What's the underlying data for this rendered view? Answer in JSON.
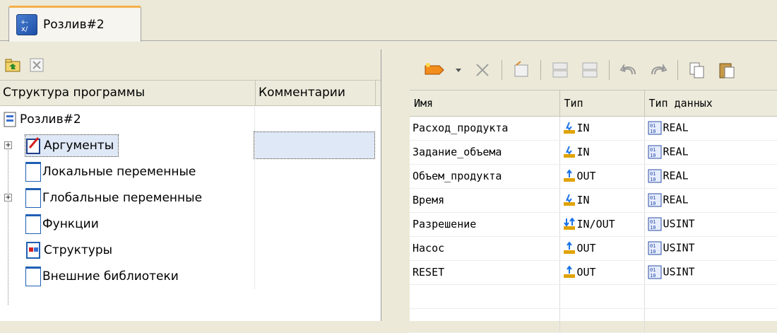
{
  "tab": {
    "label": "Розлив#2"
  },
  "left_pane": {
    "columns": [
      "Структура программы",
      "Комментарии"
    ],
    "tree": [
      {
        "label": "Розлив#2",
        "icon": "program-icon",
        "level": 0,
        "expander": false
      },
      {
        "label": "Аргументы",
        "icon": "arguments-icon",
        "level": 1,
        "expander": "+",
        "selected": true
      },
      {
        "label": "Локальные переменные",
        "icon": "document-icon",
        "level": 1,
        "expander": false
      },
      {
        "label": "Глобальные переменные",
        "icon": "document-icon",
        "level": 1,
        "expander": "+"
      },
      {
        "label": "Функции",
        "icon": "document-icon",
        "level": 1,
        "expander": false
      },
      {
        "label": "Структуры",
        "icon": "structures-icon",
        "level": 1,
        "expander": false
      },
      {
        "label": "Внешние библиотеки",
        "icon": "document-icon",
        "level": 1,
        "expander": false
      }
    ]
  },
  "right_pane": {
    "columns": [
      "Имя",
      "Тип",
      "Тип данных"
    ],
    "rows": [
      {
        "name": "Расход_продукта",
        "type": "IN",
        "dtype": "REAL"
      },
      {
        "name": "Задание_объема",
        "type": "IN",
        "dtype": "REAL"
      },
      {
        "name": "Объем_продукта",
        "type": "OUT",
        "dtype": "REAL"
      },
      {
        "name": "Время",
        "type": "IN",
        "dtype": "REAL"
      },
      {
        "name": "Разрешение",
        "type": "IN/OUT",
        "dtype": "USINT"
      },
      {
        "name": "Насос",
        "type": "OUT",
        "dtype": "USINT"
      },
      {
        "name": "RESET",
        "type": "OUT",
        "dtype": "USINT"
      }
    ]
  },
  "colors": {
    "tab_accent": "#f3b04b",
    "selection": "#dfe8f6",
    "arrow_in": "#1a73e8",
    "arrow_out": "#e0a300"
  }
}
